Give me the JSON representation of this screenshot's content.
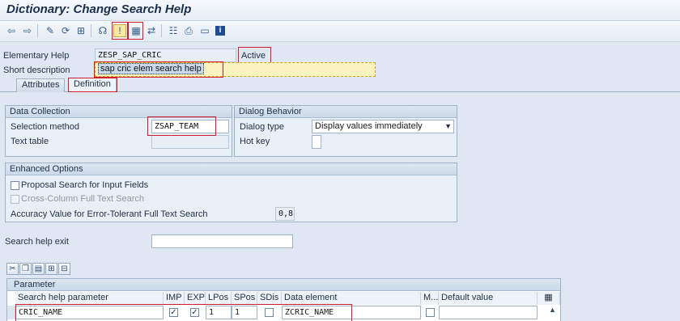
{
  "window": {
    "title": "Dictionary: Change Search Help"
  },
  "toolbar": {
    "icons": [
      "back-arrow-icon",
      "forward-arrow-icon",
      "display-change-icon",
      "other-object-icon",
      "check-icon",
      "activate-icon",
      "pattern-icon",
      "where-used-icon",
      "hierarchy-icon",
      "print-icon",
      "layout-icon",
      "info-icon"
    ]
  },
  "header": {
    "elementary_help_label": "Elementary Help",
    "elementary_help_value": "ZESP_SAP_CRIC",
    "status": "Active",
    "short_desc_label": "Short description",
    "short_desc_value": "sap cric elem search help"
  },
  "tabs": [
    {
      "label": "Attributes"
    },
    {
      "label": "Definition"
    }
  ],
  "data_collection": {
    "title": "Data Collection",
    "selection_method_label": "Selection method",
    "selection_method_value": "ZSAP_TEAM",
    "text_table_label": "Text table",
    "text_table_value": ""
  },
  "dialog_behavior": {
    "title": "Dialog Behavior",
    "dialog_type_label": "Dialog type",
    "dialog_type_value": "Display values immediately",
    "hot_key_label": "Hot key",
    "hot_key_value": ""
  },
  "enhanced_options": {
    "title": "Enhanced Options",
    "proposal_label": "Proposal Search for Input Fields",
    "cross_column_label": "Cross-Column Full Text Search",
    "accuracy_label": "Accuracy Value for Error-Tolerant Full Text Search",
    "accuracy_value": "0,8"
  },
  "exit": {
    "label": "Search help exit",
    "value": ""
  },
  "parameter_grid": {
    "title": "Parameter",
    "columns": [
      "Search help parameter",
      "IMP",
      "EXP",
      "LPos",
      "SPos",
      "SDis",
      "Data element",
      "M...",
      "Default value"
    ],
    "rows": [
      {
        "param": "CRIC_NAME",
        "imp": true,
        "exp": true,
        "lpos": "1",
        "spos": "1",
        "sdis": false,
        "data_element": "ZCRIC_NAME",
        "mod": false,
        "default": ""
      }
    ]
  }
}
